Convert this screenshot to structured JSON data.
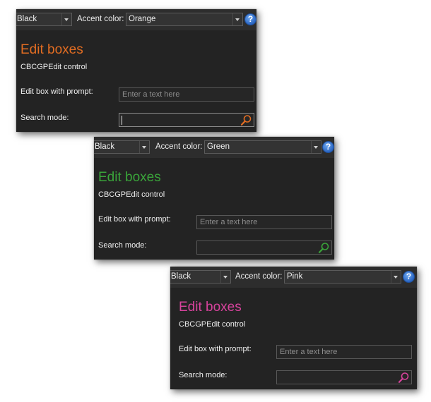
{
  "panels": [
    {
      "theme_value": "Black",
      "accent_label": "Accent color:",
      "accent_value": "Orange",
      "accent_hex": "#e36d22",
      "help_glyph": "?",
      "title": "Edit boxes",
      "subtitle": "CBCGPEdit control",
      "prompt_label": "Edit box with prompt:",
      "prompt_placeholder": "Enter a text here",
      "search_label": "Search mode:",
      "search_value": "",
      "search_focused": true
    },
    {
      "theme_value": "Black",
      "accent_label": "Accent color:",
      "accent_value": "Green",
      "accent_hex": "#3aa43a",
      "help_glyph": "?",
      "title": "Edit boxes",
      "subtitle": "CBCGPEdit control",
      "prompt_label": "Edit box with prompt:",
      "prompt_placeholder": "Enter a text here",
      "search_label": "Search mode:",
      "search_value": "",
      "search_focused": false
    },
    {
      "theme_value": "Black",
      "accent_label": "Accent color:",
      "accent_value": "Pink",
      "accent_hex": "#d6439c",
      "help_glyph": "?",
      "title": "Edit boxes",
      "subtitle": "CBCGPEdit control",
      "prompt_label": "Edit box with prompt:",
      "prompt_placeholder": "Enter a text here",
      "search_label": "Search mode:",
      "search_value": "",
      "search_focused": false
    }
  ],
  "icons": {
    "search": "search-icon",
    "help": "help-icon",
    "dropdown": "chevron-down-icon"
  }
}
